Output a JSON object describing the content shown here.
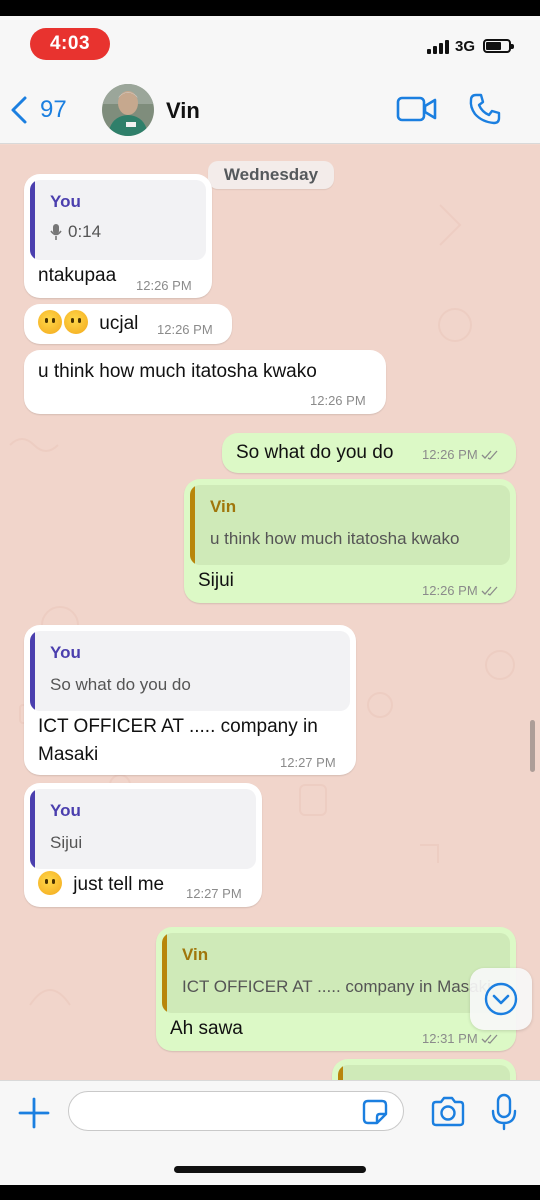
{
  "status_bar": {
    "time": "4:03",
    "network": "3G",
    "battery_level": 0.7
  },
  "header": {
    "back_count": "97",
    "contact_name": "Vin"
  },
  "chat": {
    "day_label": "Wednesday",
    "messages": [
      {
        "dir": "in",
        "quote": {
          "name": "You",
          "text": "0:14",
          "kind": "voice"
        },
        "text": "ntakupaa",
        "time": "12:26 PM"
      },
      {
        "dir": "in",
        "text": "ucjal",
        "emoji": "hand-over-mouth-emoji",
        "time": "12:26 PM"
      },
      {
        "dir": "in",
        "text": "u think how much itatosha kwako",
        "time": "12:26 PM"
      },
      {
        "dir": "out",
        "text": "So what do you do",
        "time": "12:26 PM"
      },
      {
        "dir": "out",
        "quote": {
          "name": "Vin",
          "text": "u think how much itatosha kwako"
        },
        "text": "Sijui",
        "time": "12:26 PM"
      },
      {
        "dir": "in",
        "quote": {
          "name": "You",
          "text": "So what do you do"
        },
        "text_lines": [
          "ICT OFFICER AT ..... company in",
          "Masaki"
        ],
        "time": "12:27 PM"
      },
      {
        "dir": "in",
        "quote": {
          "name": "You",
          "text": "Sijui"
        },
        "text": "just tell me",
        "emoji": "pleading-face-emoji",
        "time": "12:27 PM"
      },
      {
        "dir": "out",
        "quote": {
          "name": "Vin",
          "text": "ICT OFFICER AT ..... company in Masaki"
        },
        "text": "Ah sawa",
        "time": "12:31 PM"
      }
    ]
  },
  "composer": {
    "placeholder": ""
  },
  "colors": {
    "accent": "#1b7fe0",
    "incoming": "#ffffff",
    "outgoing": "#dcf9c6",
    "time_pill": "#e8332f"
  }
}
